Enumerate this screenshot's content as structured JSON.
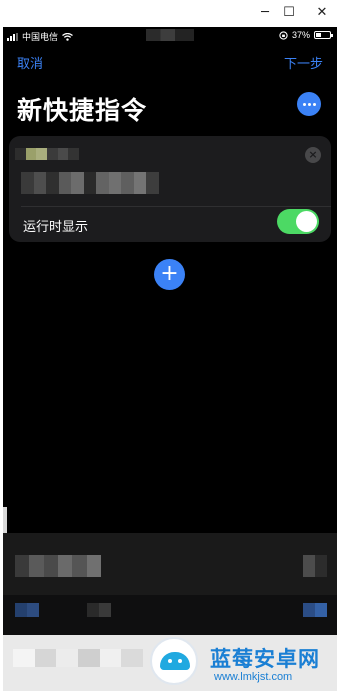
{
  "window": {
    "minimize": "─",
    "maximize": "☐",
    "close": "✕"
  },
  "status_bar": {
    "carrier": "中国电信",
    "battery": "37%"
  },
  "nav": {
    "cancel": "取消",
    "next": "下一步"
  },
  "page": {
    "title": "新快捷指令"
  },
  "action_card": {
    "toggle_label": "运行时显示",
    "toggle_on": true
  },
  "colors": {
    "accent": "#3b82f6",
    "toggle_on": "#4cd964",
    "card_bg": "#1c1c1e"
  },
  "watermark": {
    "name": "蓝莓安卓网",
    "url": "www.lmkjst.com"
  }
}
